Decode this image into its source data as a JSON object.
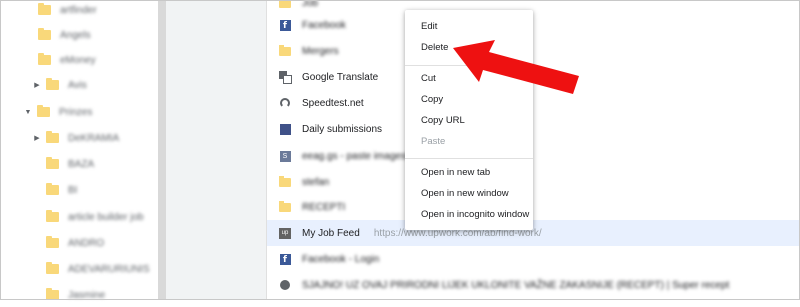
{
  "sidebar": {
    "items": [
      {
        "label": "artfinder",
        "expanded": null
      },
      {
        "label": "Angels",
        "expanded": null
      },
      {
        "label": "eMoney",
        "expanded": null
      },
      {
        "label": "Avis",
        "expanded": "collapsed"
      },
      {
        "label": "Prinzes",
        "expanded": "expanded"
      },
      {
        "label": "DeKRAMIA",
        "expanded": "collapsed"
      },
      {
        "label": "BAZA",
        "expanded": null
      },
      {
        "label": "BI",
        "expanded": null
      },
      {
        "label": "article builder job",
        "expanded": null
      },
      {
        "label": "ANDRO",
        "expanded": null
      },
      {
        "label": "ADEVARURIUNIS",
        "expanded": null
      },
      {
        "label": "Jasmine",
        "expanded": null
      }
    ]
  },
  "bookmarks": [
    {
      "icon": "folder-icon",
      "title": "Job"
    },
    {
      "icon": "facebook-icon",
      "title": "Facebook"
    },
    {
      "icon": "folder-icon",
      "title": "Mergers"
    },
    {
      "icon": "google-translate-icon",
      "title": "Google Translate"
    },
    {
      "icon": "speedtest-icon",
      "title": "Speedtest.net"
    },
    {
      "icon": "sheet-icon",
      "title": "Daily submissions"
    },
    {
      "icon": "s-icon",
      "title": "eeag.gs - paste images!"
    },
    {
      "icon": "folder-icon",
      "title": "stefan"
    },
    {
      "icon": "folder-icon",
      "title": "RECEPTI"
    },
    {
      "icon": "upwork-icon",
      "title": "My Job Feed",
      "url": "https://www.upwork.com/ab/find-work/",
      "selected": true
    },
    {
      "icon": "facebook-icon",
      "title": "Facebook - Login"
    },
    {
      "icon": "globe-icon",
      "title": "SJAJNO! UZ OVAJ PRIRODNI LIJEK UKLONITE VAŽNE ZAKASNIJE (RECEPT) | Super recept"
    }
  ],
  "context_menu": {
    "items": [
      "Edit",
      "Delete",
      "Cut",
      "Copy",
      "Copy URL",
      "Paste",
      "Open in new tab",
      "Open in new window",
      "Open in incognito window"
    ]
  },
  "colors": {
    "selected_row": "#e8f0fe",
    "folder": "#f9d87a",
    "annotation_arrow": "#ee1111"
  }
}
